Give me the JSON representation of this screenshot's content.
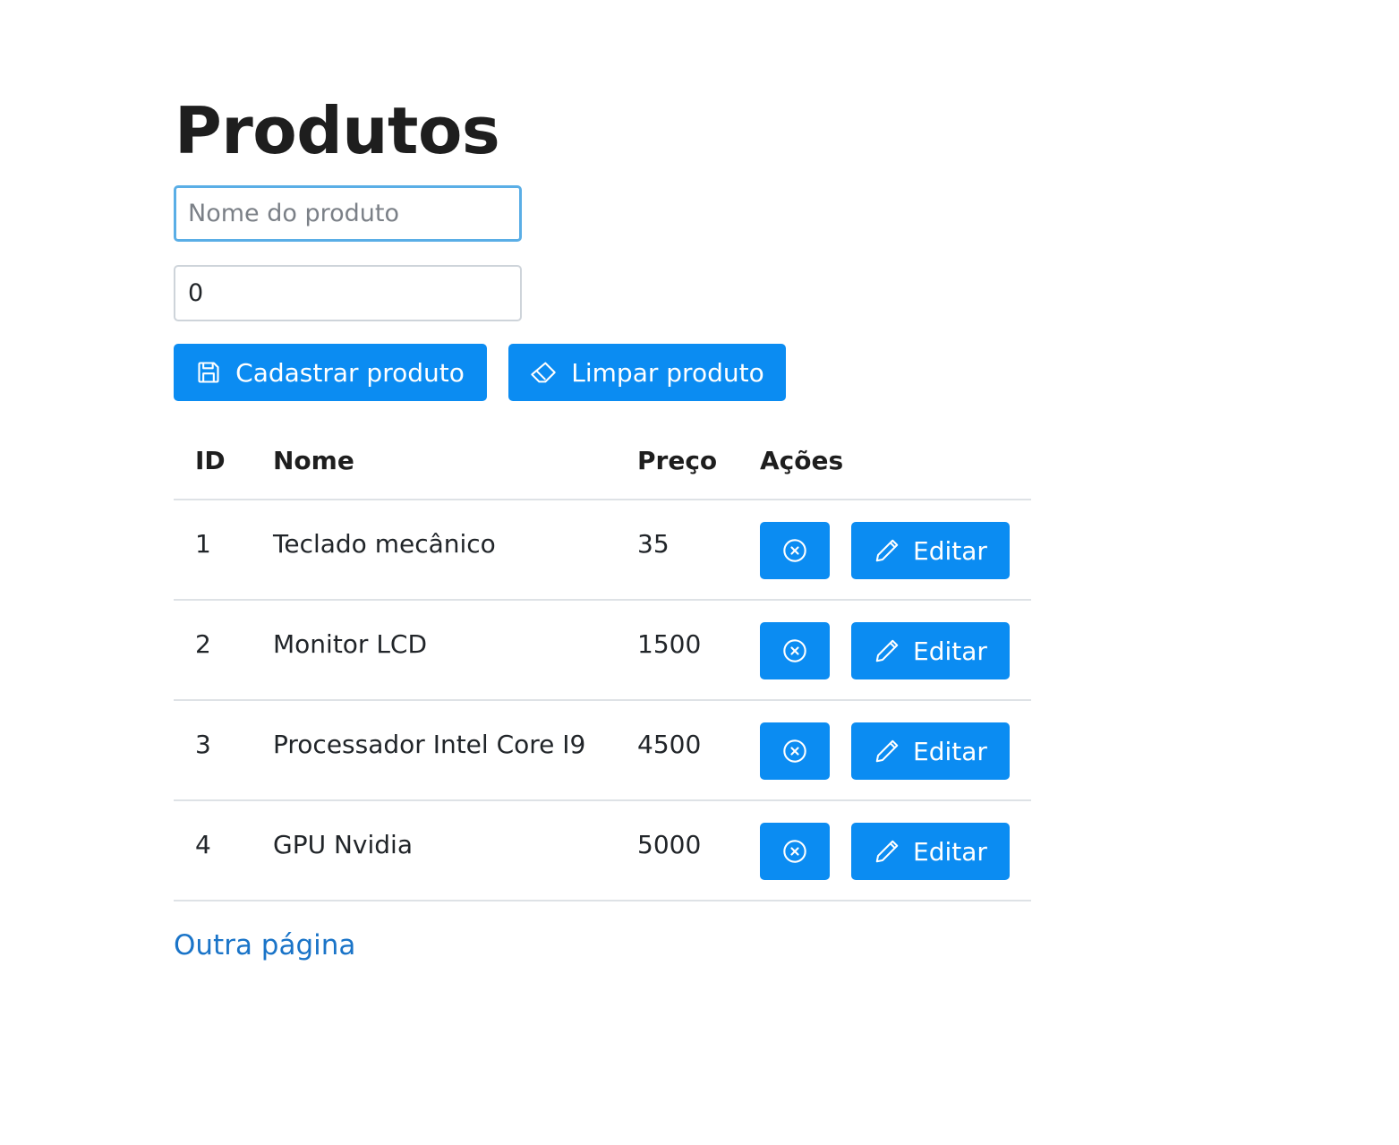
{
  "page": {
    "title": "Produtos"
  },
  "form": {
    "name_placeholder": "Nome do produto",
    "name_value": "",
    "price_value": "0",
    "save_label": "Cadastrar produto",
    "clear_label": "Limpar produto"
  },
  "table": {
    "headers": [
      "ID",
      "Nome",
      "Preço",
      "Ações"
    ],
    "edit_label": "Editar",
    "rows": [
      {
        "id": "1",
        "nome": "Teclado mecânico",
        "preco": "35"
      },
      {
        "id": "2",
        "nome": "Monitor LCD",
        "preco": "1500"
      },
      {
        "id": "3",
        "nome": "Processador Intel Core I9",
        "preco": "4500"
      },
      {
        "id": "4",
        "nome": "GPU Nvidia",
        "preco": "5000"
      }
    ]
  },
  "footer": {
    "link_label": "Outra página"
  },
  "colors": {
    "primary": "#0b8cf2",
    "link": "#1a74c8",
    "focus_border": "#5aaee6"
  },
  "icons": {
    "save": "floppy-disk-icon",
    "clear": "eraser-icon",
    "delete": "x-circle-icon",
    "edit": "pencil-icon"
  }
}
